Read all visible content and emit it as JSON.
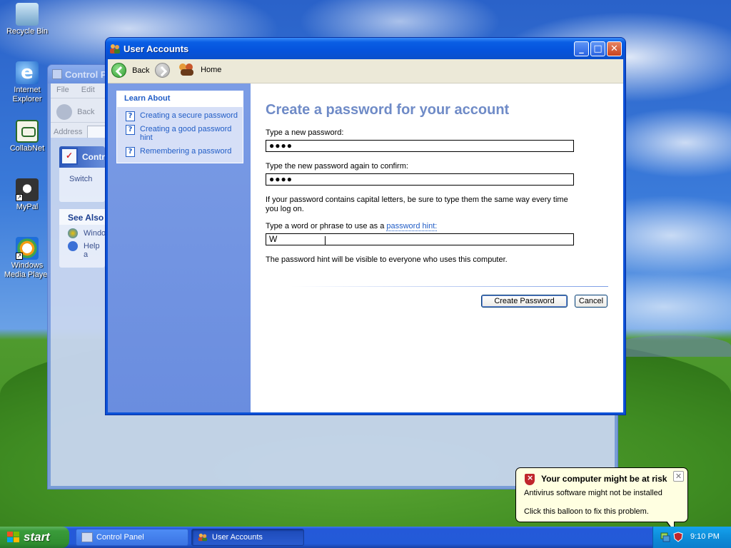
{
  "desktop": {
    "icons": [
      {
        "label": "Recycle Bin"
      },
      {
        "label": "Internet Explorer"
      },
      {
        "label": "CollabNet"
      },
      {
        "label": "MyPal"
      },
      {
        "label": "Windows Media Player"
      }
    ]
  },
  "control_panel": {
    "title": "Control P",
    "menu": [
      "File",
      "Edit"
    ],
    "back_label": "Back",
    "address_label": "Address",
    "taskpane_title": "Contr",
    "taskpane_item": "Switch",
    "see_also_title": "See Also",
    "see_also_items": [
      "Windo",
      "Help a"
    ]
  },
  "window": {
    "title": "User Accounts",
    "minimize_glyph": "_",
    "maximize_glyph": "□",
    "close_glyph": "✕"
  },
  "toolbar": {
    "back_label": "Back",
    "home_label": "Home"
  },
  "learn_about": {
    "title": "Learn About",
    "items": [
      {
        "label": "Creating a secure password"
      },
      {
        "label": "Creating a good password hint"
      },
      {
        "label": "Remembering a password"
      }
    ]
  },
  "form": {
    "title": "Create a password for your account",
    "new_password_label": "Type a new password:",
    "new_password_value": "●●●●",
    "confirm_label": "Type the new password again to confirm:",
    "confirm_value": "●●●●",
    "caps_note": "If your password contains capital letters, be sure to type them the same way every time you log on.",
    "hint_label_prefix": "Type a word or phrase to use as a ",
    "hint_link": "password hint:",
    "hint_value": "W",
    "hint_note": "The password hint will be visible to everyone who uses this computer.",
    "create_button": "Create Password",
    "cancel_button": "Cancel"
  },
  "balloon": {
    "title": "Your computer might be at risk",
    "line1": "Antivirus software might not be installed",
    "line2": "Click this balloon to fix this problem.",
    "close_glyph": "✕"
  },
  "taskbar": {
    "start_label": "start",
    "tasks": [
      {
        "label": "Control Panel"
      },
      {
        "label": "User Accounts"
      }
    ],
    "clock": "9:10 PM"
  }
}
